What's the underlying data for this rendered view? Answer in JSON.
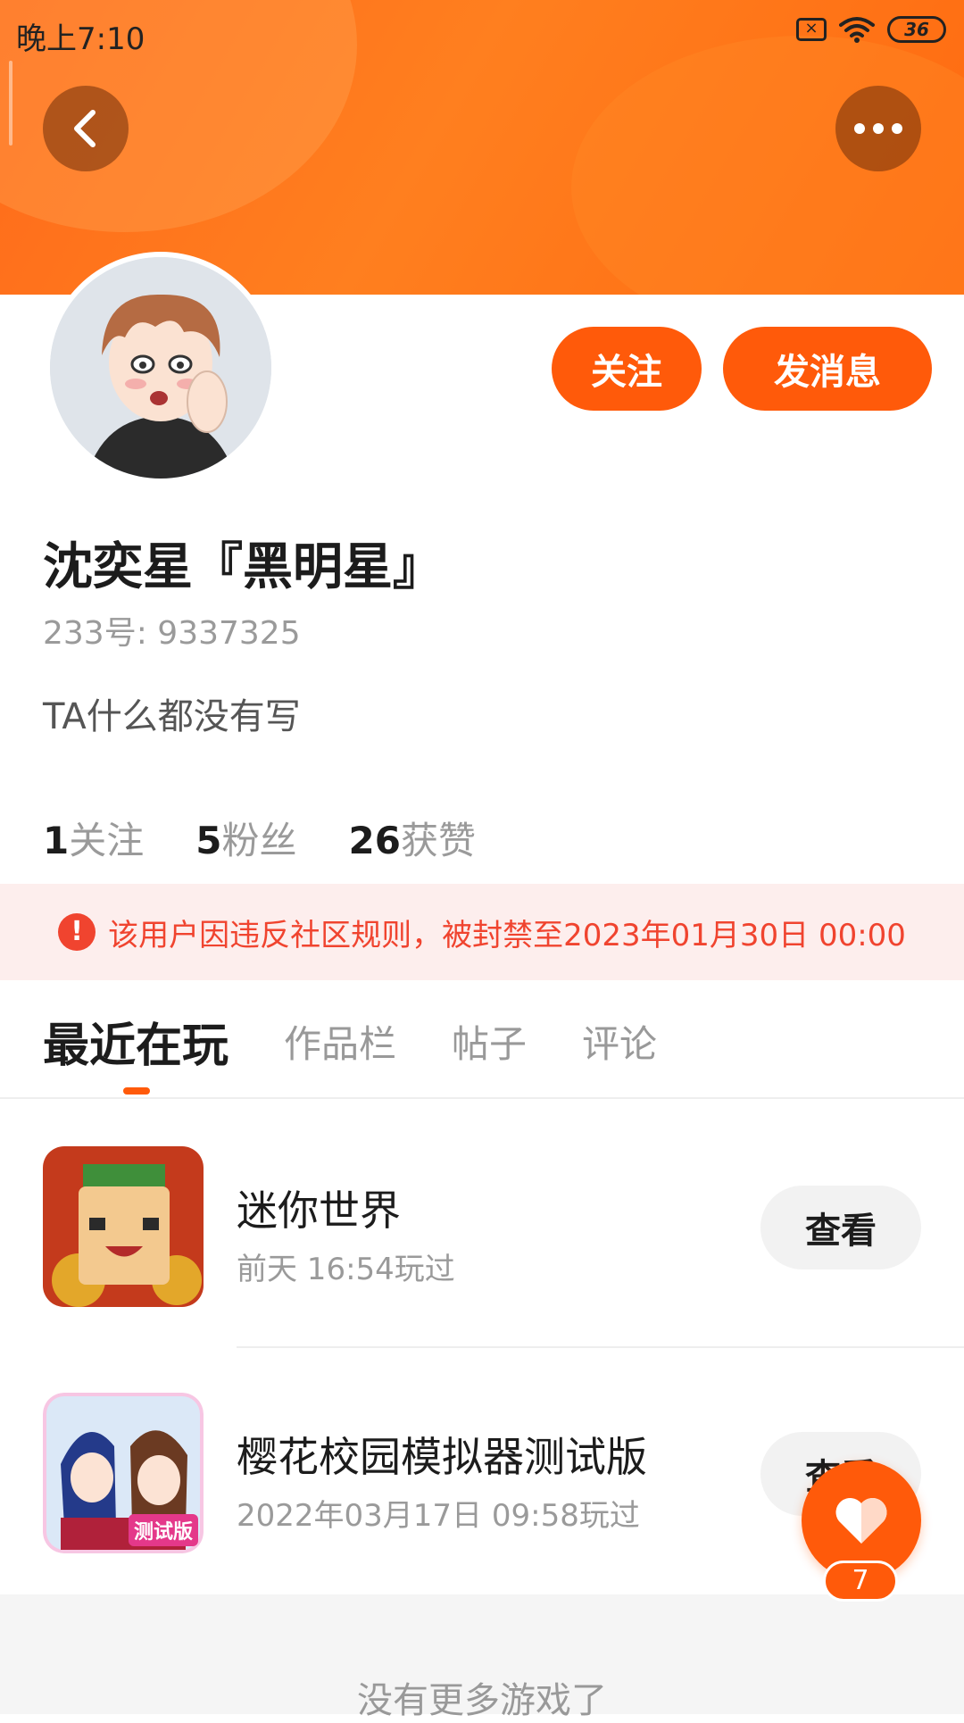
{
  "status_bar": {
    "time": "晚上7:10",
    "battery": "36"
  },
  "profile": {
    "follow_label": "关注",
    "message_label": "发消息",
    "username": "沈奕星『黑明星』",
    "account_id": "233号: 9337325",
    "bio": "TA什么都没有写",
    "stats": [
      {
        "num": "1",
        "label": "关注"
      },
      {
        "num": "5",
        "label": "粉丝"
      },
      {
        "num": "26",
        "label": "获赞"
      }
    ]
  },
  "ban_notice": {
    "text": "该用户因违反社区规则，被封禁至2023年01月30日 00:00"
  },
  "tabs": [
    {
      "label": "最近在玩"
    },
    {
      "label": "作品栏"
    },
    {
      "label": "帖子"
    },
    {
      "label": "评论"
    }
  ],
  "games": [
    {
      "name": "迷你世界",
      "time": "前天 16:54玩过",
      "action": "查看",
      "badge": ""
    },
    {
      "name": "樱花校园模拟器测试版",
      "time": "2022年03月17日 09:58玩过",
      "action": "查看",
      "badge": "测试版"
    }
  ],
  "footer": {
    "text": "没有更多游戏了"
  },
  "like": {
    "count": "7"
  },
  "colors": {
    "accent": "#ff5a0a",
    "ban_text": "#f0442f",
    "ban_bg": "#fdeeed"
  },
  "icons": [
    "back-icon",
    "more-icon",
    "heart-icon",
    "alert-icon",
    "wifi-icon",
    "battery-icon"
  ]
}
